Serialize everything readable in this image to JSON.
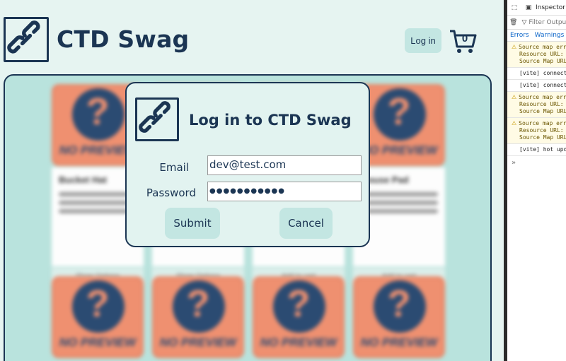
{
  "app": {
    "brand": "CTD Swag",
    "login_label": "Log in",
    "cart_count": "0"
  },
  "modal": {
    "title": "Log in to CTD Swag",
    "email_label": "Email",
    "email_value": "dev@test.com",
    "password_label": "Password",
    "password_mask": "●●●●●●●●●●●",
    "submit_label": "Submit",
    "cancel_label": "Cancel"
  },
  "background_cards": {
    "placeholder_mark": "?",
    "placeholder_caption": "NO PREVIEW",
    "row1": [
      {
        "title": "Bucket Hat",
        "action": "Show Options"
      },
      {
        "title": "",
        "action": "Show Options"
      },
      {
        "title": "",
        "action": "Add to cart"
      },
      {
        "title": "Mouse Pad",
        "action": "Add to cart"
      }
    ]
  },
  "devtools": {
    "tab_inspector": "Inspector",
    "filter_placeholder": "Filter Output",
    "tabs": [
      "Errors",
      "Warnings"
    ],
    "messages": [
      {
        "kind": "warn",
        "lines": [
          "Source map error",
          "Resource URL:",
          "Source Map URL:"
        ]
      },
      {
        "kind": "log",
        "lines": [
          "[vite] connecting..."
        ]
      },
      {
        "kind": "log",
        "lines": [
          "[vite] connected."
        ]
      },
      {
        "kind": "warn",
        "lines": [
          "Source map error",
          "Resource URL:",
          "Source Map URL:"
        ]
      },
      {
        "kind": "warn",
        "lines": [
          "Source map error",
          "Resource URL:",
          "Source Map URL:"
        ]
      },
      {
        "kind": "log",
        "lines": [
          "[vite] hot updated"
        ]
      }
    ],
    "prompt": "»"
  }
}
